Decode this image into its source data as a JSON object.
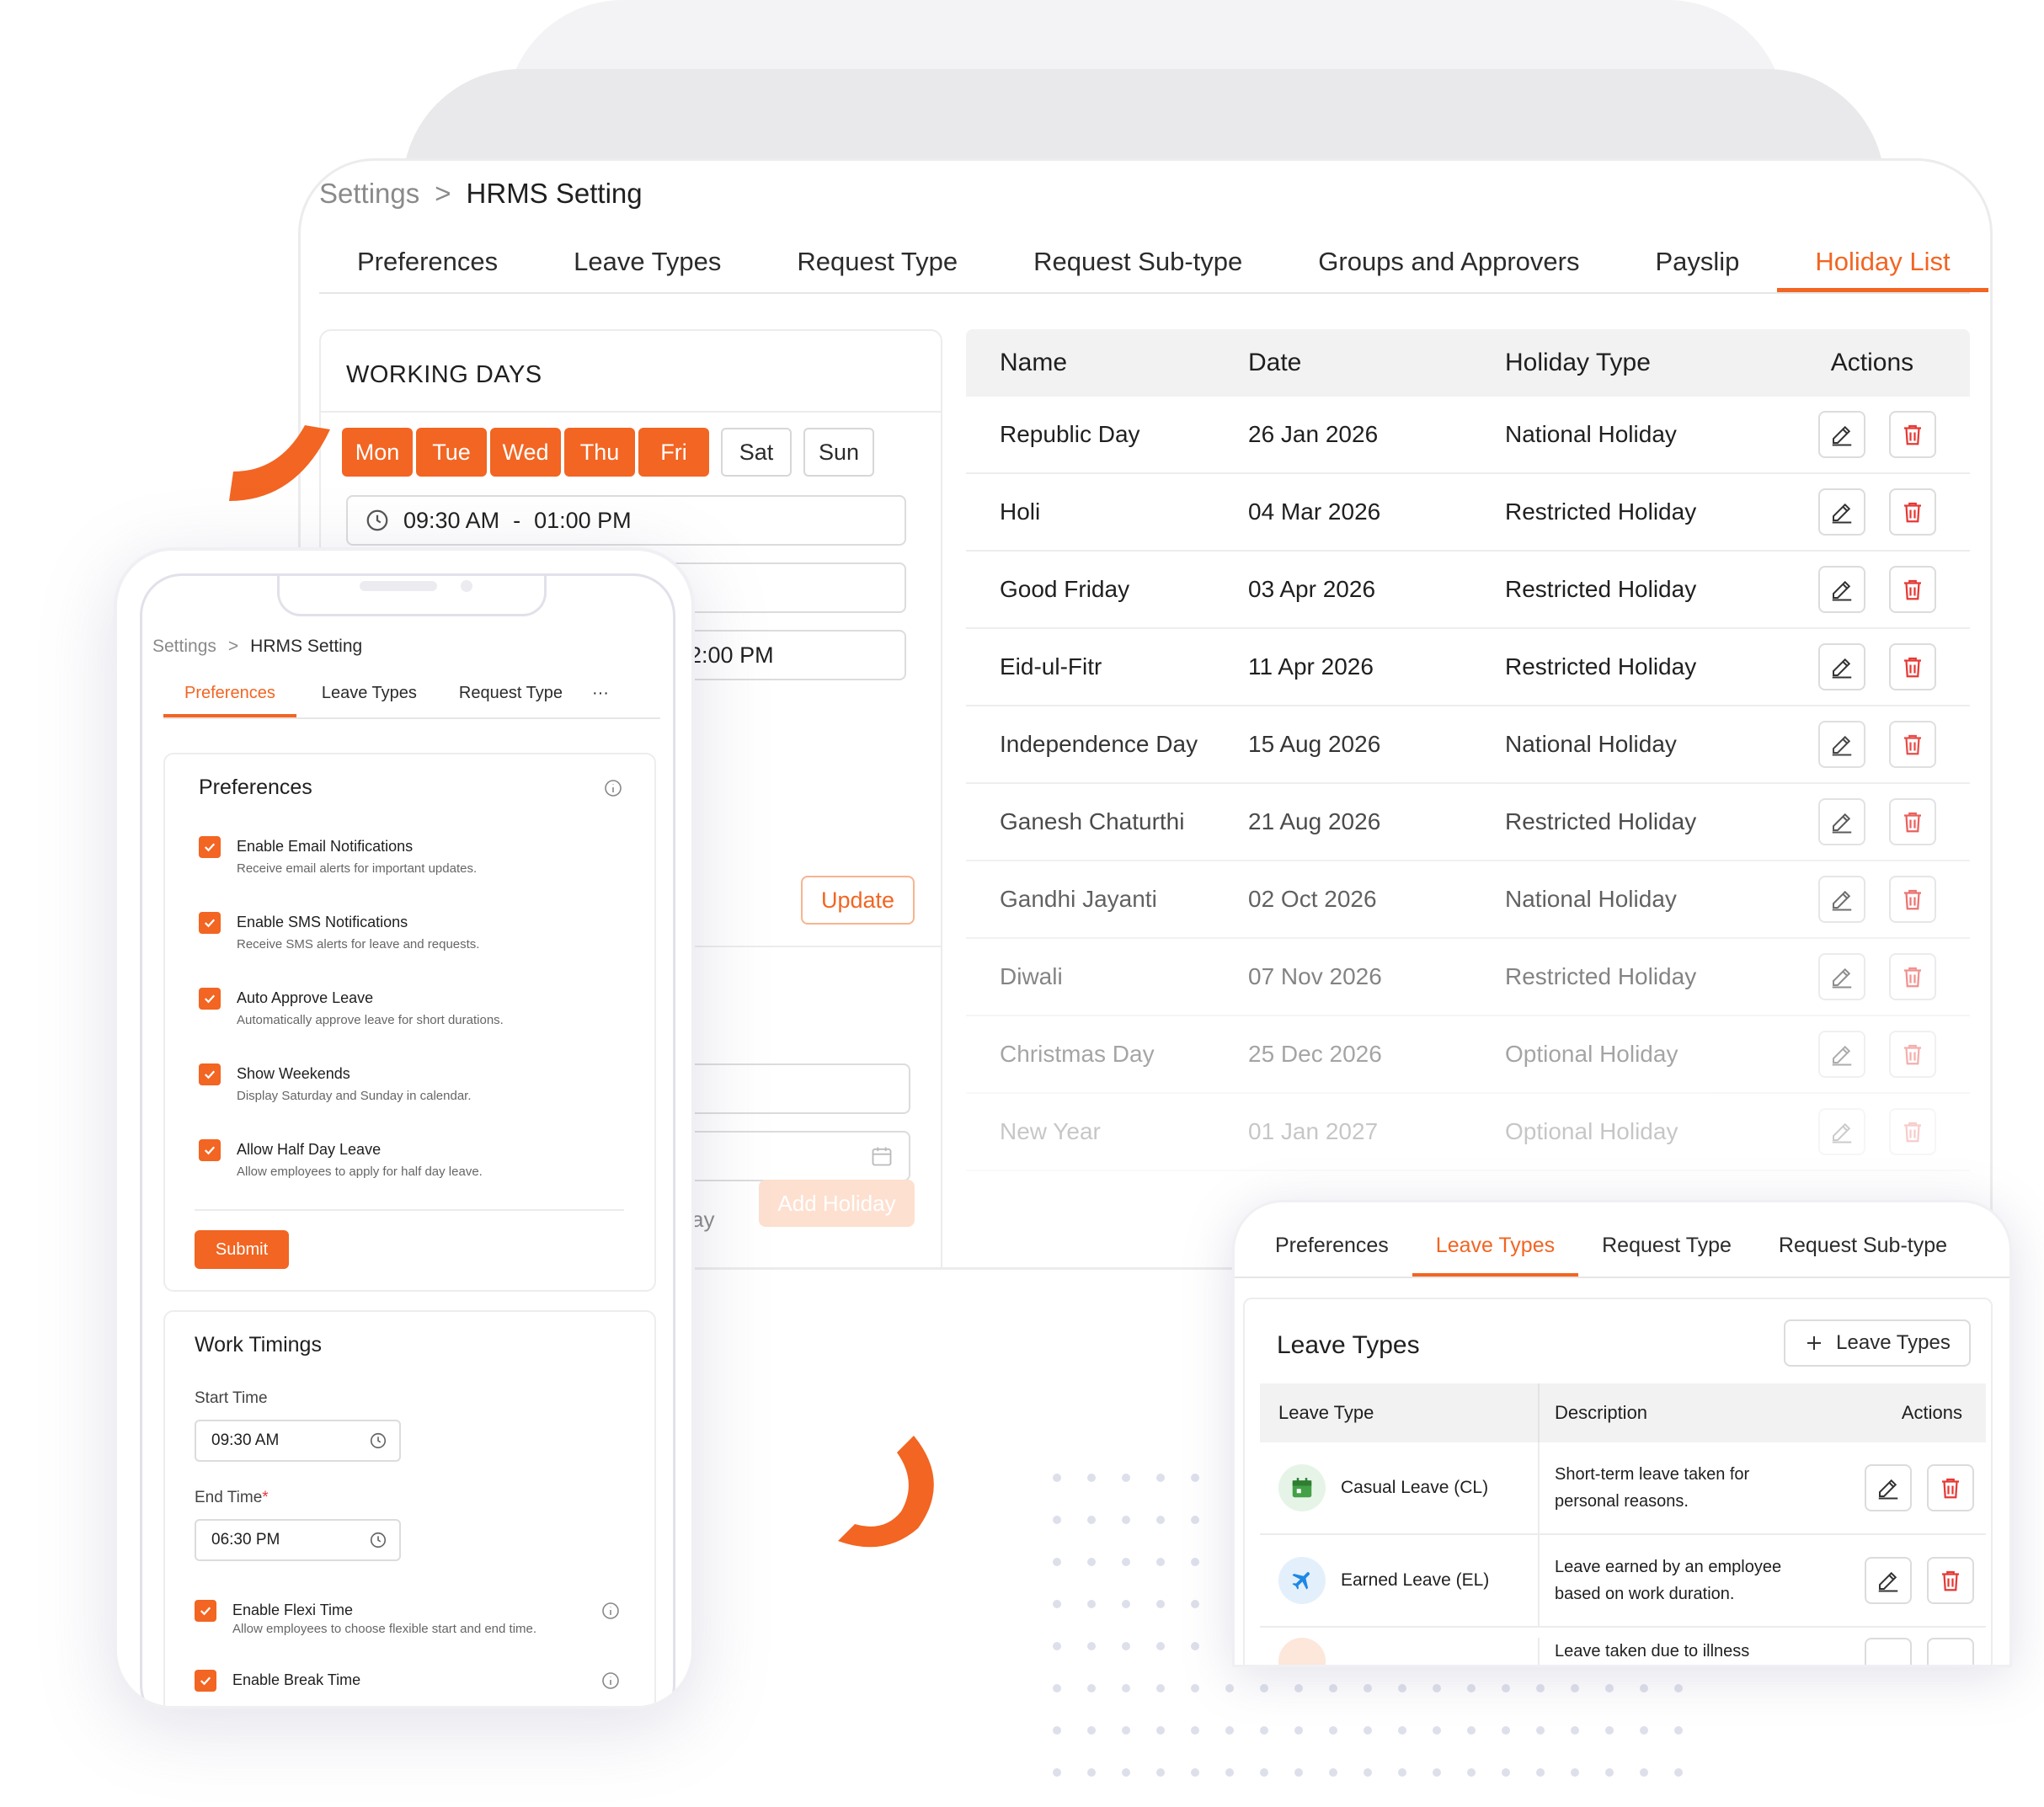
{
  "breadcrumb": {
    "parent": "Settings",
    "sep": ">",
    "current": "HRMS Setting"
  },
  "tabs": [
    "Preferences",
    "Leave Types",
    "Request Type",
    "Request Sub-type",
    "Groups and Approvers",
    "Payslip",
    "Holiday List"
  ],
  "active_tab": "Holiday List",
  "working_days": {
    "title": "WORKING DAYS",
    "days": [
      {
        "label": "Mon",
        "selected": true
      },
      {
        "label": "Tue",
        "selected": true
      },
      {
        "label": "Wed",
        "selected": true
      },
      {
        "label": "Thu",
        "selected": true
      },
      {
        "label": "Fri",
        "selected": true
      },
      {
        "label": "Sat",
        "selected": false
      },
      {
        "label": "Sun",
        "selected": false
      }
    ],
    "time_start": "09:30 AM",
    "time_sep": "-",
    "time_end": "01:00 PM",
    "time_2": "02:00 PM",
    "update_label": "Update",
    "partial_label": "ay",
    "add_holiday_label": "Add Holiday"
  },
  "holiday_table": {
    "headers": [
      "Name",
      "Date",
      "Holiday Type",
      "Actions"
    ],
    "rows": [
      {
        "name": "Republic Day",
        "date": "26 Jan 2026",
        "type": "National Holiday"
      },
      {
        "name": "Holi",
        "date": "04 Mar 2026",
        "type": "Restricted Holiday"
      },
      {
        "name": "Good Friday",
        "date": "03 Apr 2026",
        "type": "Restricted Holiday"
      },
      {
        "name": "Eid-ul-Fitr",
        "date": "11 Apr 2026",
        "type": "Restricted Holiday"
      },
      {
        "name": "Independence Day",
        "date": "15 Aug 2026",
        "type": "National Holiday"
      },
      {
        "name": "Ganesh Chaturthi",
        "date": "21 Aug 2026",
        "type": "Restricted Holiday"
      },
      {
        "name": "Gandhi Jayanti",
        "date": "02 Oct 2026",
        "type": "National Holiday"
      },
      {
        "name": "Diwali",
        "date": "07 Nov 2026",
        "type": "Restricted Holiday"
      },
      {
        "name": "Christmas Day",
        "date": "25 Dec 2026",
        "type": "Optional Holiday"
      },
      {
        "name": "New Year",
        "date": "01 Jan 2027",
        "type": "Optional Holiday"
      }
    ]
  },
  "phone": {
    "breadcrumb": {
      "parent": "Settings",
      "sep": ">",
      "current": "HRMS Setting"
    },
    "tabs": [
      "Preferences",
      "Leave Types",
      "Request Type"
    ],
    "more": "···",
    "preferences": {
      "title": "Preferences",
      "items": [
        {
          "title": "Enable Email Notifications",
          "desc": "Receive email alerts for important updates."
        },
        {
          "title": "Enable SMS Notifications",
          "desc": "Receive SMS alerts for leave and requests."
        },
        {
          "title": "Auto Approve Leave",
          "desc": "Automatically approve leave for short durations."
        },
        {
          "title": "Show Weekends",
          "desc": "Display Saturday and Sunday in calendar."
        },
        {
          "title": "Allow Half Day Leave",
          "desc": "Allow employees to apply for half day leave."
        }
      ],
      "submit_label": "Submit"
    },
    "work_timings": {
      "title": "Work Timings",
      "start_label": "Start Time",
      "start_value": "09:30 AM",
      "end_label": "End Time",
      "end_required": "*",
      "end_value": "06:30 PM",
      "flexi_title": "Enable Flexi Time",
      "flexi_desc": "Allow employees to choose flexible start and end time.",
      "break_title": "Enable Break Time"
    }
  },
  "leave_panel": {
    "tabs": [
      "Preferences",
      "Leave Types",
      "Request Type",
      "Request Sub-type"
    ],
    "active_tab": "Leave Types",
    "title": "Leave Types",
    "add_label": "Leave Types",
    "headers": [
      "Leave Type",
      "Description",
      "Actions"
    ],
    "rows": [
      {
        "type": "Casual Leave (CL)",
        "desc_1": "Short-term leave taken for",
        "desc_2": "personal reasons."
      },
      {
        "type": "Earned Leave (EL)",
        "desc_1": "Leave earned by an employee",
        "desc_2": "based on work duration."
      },
      {
        "type": "",
        "desc_1": "Leave taken due to illness",
        "desc_2": ""
      }
    ]
  },
  "colors": {
    "accent": "#f26522",
    "delete": "#e53935",
    "earned_icon": "#1e88e5",
    "casual_icon": "#43a047"
  }
}
